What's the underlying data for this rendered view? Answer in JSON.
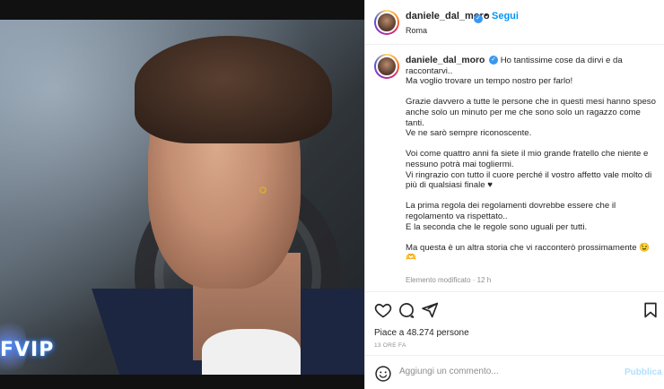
{
  "post": {
    "username": "daniele_dal_moro",
    "follow_label": "Segui",
    "location": "Roma",
    "verified_glyph": "✓",
    "dot": "•"
  },
  "caption": {
    "lines": [
      "Ho tantissime cose da dirvi e da raccontarvi..",
      "Ma voglio trovare un tempo nostro per farlo!"
    ],
    "paragraphs": [
      "Grazie davvero a tutte le persone che in questi mesi hanno speso anche solo un minuto per me che sono solo un ragazzo come tanti.\nVe ne sarò sempre riconoscente.",
      "Voi come quattro anni fa siete il mio grande fratello che niente e nessuno potrà mai togliermi.\nVi ringrazio con tutto il cuore perché il vostro affetto vale molto di più di qualsiasi finale ♥",
      "La prima regola dei regolamenti dovrebbe essere che il regolamento va rispettato..\nE la seconda che le regole sono uguali per tutti.",
      "Ma questa è un altra storia che vi racconterò prossimamente 😉\n🫶"
    ],
    "meta": "Elemento modificato · 12 h"
  },
  "stats": {
    "likes": "Piace a 48.274 persone",
    "time": "13 ORE FA"
  },
  "comment": {
    "placeholder": "Aggiungi un commento...",
    "publish_label": "Pubblica",
    "emoji_icon": "☺"
  },
  "media": {
    "logo_text": "FVIP"
  },
  "icons": {
    "like": "heart-icon",
    "comment": "comment-icon",
    "share": "share-icon",
    "save": "bookmark-icon"
  },
  "colors": {
    "accent": "#0095f6",
    "verified": "#3897f0",
    "publish_disabled": "#b2dffc"
  }
}
